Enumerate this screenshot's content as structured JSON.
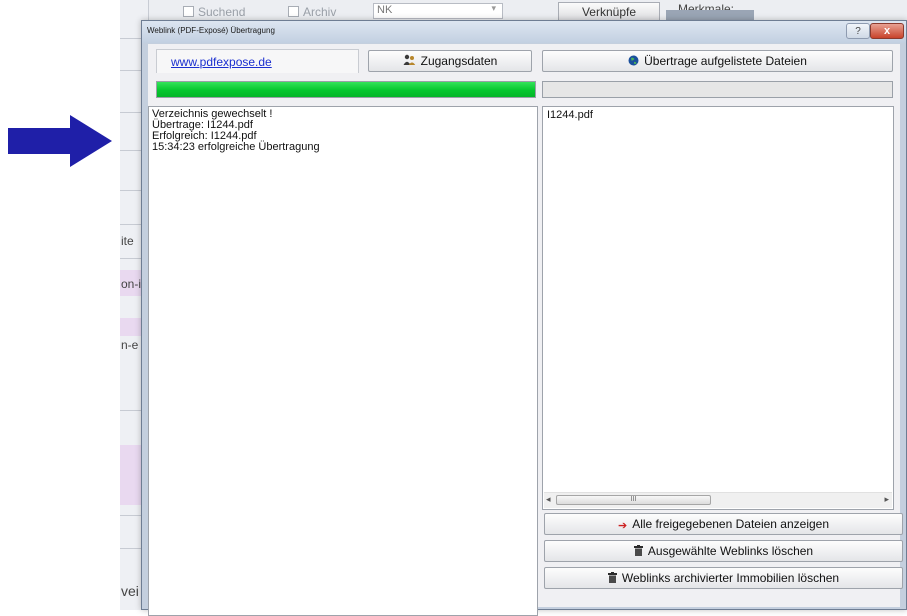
{
  "background": {
    "filter_suchend": "Suchend",
    "filter_archiv": "Archiv",
    "combo_value": "NK",
    "button_verknuepfe": "Verknüpfe",
    "label_merkmale": "Merkmale:",
    "cut_texts": [
      "ite",
      "on-i",
      "n-e",
      "vei"
    ]
  },
  "dialog": {
    "title": "Weblink (PDF-Exposé) Übertragung",
    "help_button": "?",
    "close_button": "x",
    "url_link": "www.pdfexpose.de",
    "zugangsdaten_button": "Zugangsdaten",
    "uebertrage_button": "Übertrage aufgelistete Dateien",
    "progress_left_percent": 100,
    "progress_right_percent": 0,
    "log_lines": [
      "Verzeichnis gewechselt !",
      "Übertrage: I1244.pdf",
      "Erfolgreich: I1244.pdf",
      "15:34:23 erfolgreiche Übertragung"
    ],
    "file_list": [
      "I1244.pdf"
    ],
    "scroll_thumb_label": "III",
    "btn_alle_freigegebenen": "Alle freigegebenen Dateien anzeigen",
    "btn_ausgewaehlte_loeschen": "Ausgewählte Weblinks löschen",
    "btn_archivierte_loeschen": "Weblinks archivierter Immobilien löschen"
  },
  "colors": {
    "arrow": "#1f1fa8",
    "progress_green": "#06c72f",
    "link_blue": "#1b2fd0",
    "window_frame": "#c4cfde"
  }
}
